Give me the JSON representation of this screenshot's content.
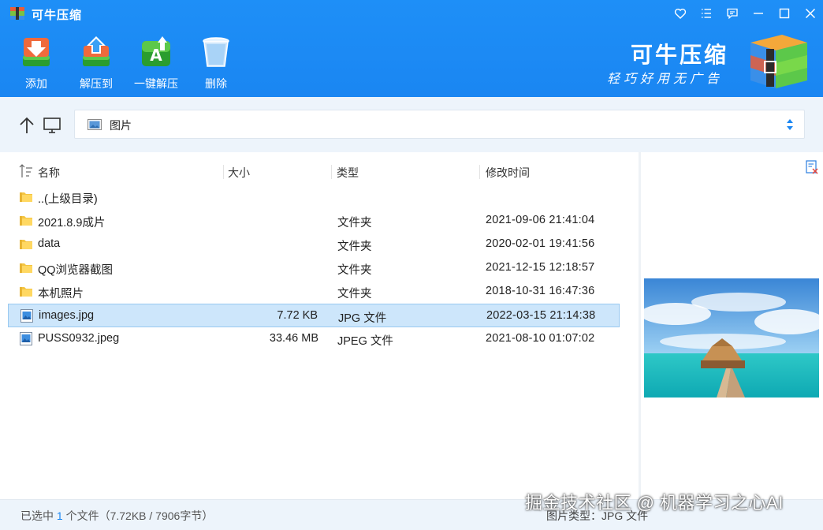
{
  "window": {
    "title": "可牛压缩",
    "controls": [
      "heart-icon",
      "list-icon",
      "feedback-icon",
      "minimize-icon",
      "maximize-icon",
      "close-icon"
    ]
  },
  "toolbar": {
    "add_label": "添加",
    "extract_to_label": "解压到",
    "one_click_extract_label": "一键解压",
    "delete_label": "删除"
  },
  "brand": {
    "name": "可牛压缩",
    "slogan": "轻巧好用无广告"
  },
  "address": {
    "path": "图片"
  },
  "columns": {
    "name": "名称",
    "size": "大小",
    "type": "类型",
    "modified": "修改时间"
  },
  "files": [
    {
      "name": "..(上级目录)",
      "size": "",
      "type": "",
      "modified": "",
      "icon": "folder-icon",
      "selected": false
    },
    {
      "name": "2021.8.9成片",
      "size": "",
      "type": "文件夹",
      "modified": "2021-09-06 21:41:04",
      "icon": "folder-icon",
      "selected": false
    },
    {
      "name": "data",
      "size": "",
      "type": "文件夹",
      "modified": "2020-02-01 19:41:56",
      "icon": "folder-icon",
      "selected": false
    },
    {
      "name": "QQ浏览器截图",
      "size": "",
      "type": "文件夹",
      "modified": "2021-12-15 12:18:57",
      "icon": "folder-icon",
      "selected": false
    },
    {
      "name": "本机照片",
      "size": "",
      "type": "文件夹",
      "modified": "2018-10-31 16:47:36",
      "icon": "folder-icon",
      "selected": false
    },
    {
      "name": "images.jpg",
      "size": "7.72 KB",
      "type": "JPG 文件",
      "modified": "2022-03-15 21:14:38",
      "icon": "image-file-icon",
      "selected": true
    },
    {
      "name": "PUSS0932.jpeg",
      "size": "33.46 MB",
      "type": "JPEG 文件",
      "modified": "2021-08-10 01:07:02",
      "icon": "image-file-icon",
      "selected": false
    }
  ],
  "status": {
    "prefix": "已选中",
    "count": "1",
    "suffix": "个文件（7.72KB / 7906字节）",
    "right": "图片类型：JPG 文件"
  },
  "watermark": "掘金技术社区 @ 机器学习之心AI",
  "colors": {
    "accent": "#1a86f2",
    "selection": "#cde6fb",
    "nav_background": "#edf4fb"
  }
}
